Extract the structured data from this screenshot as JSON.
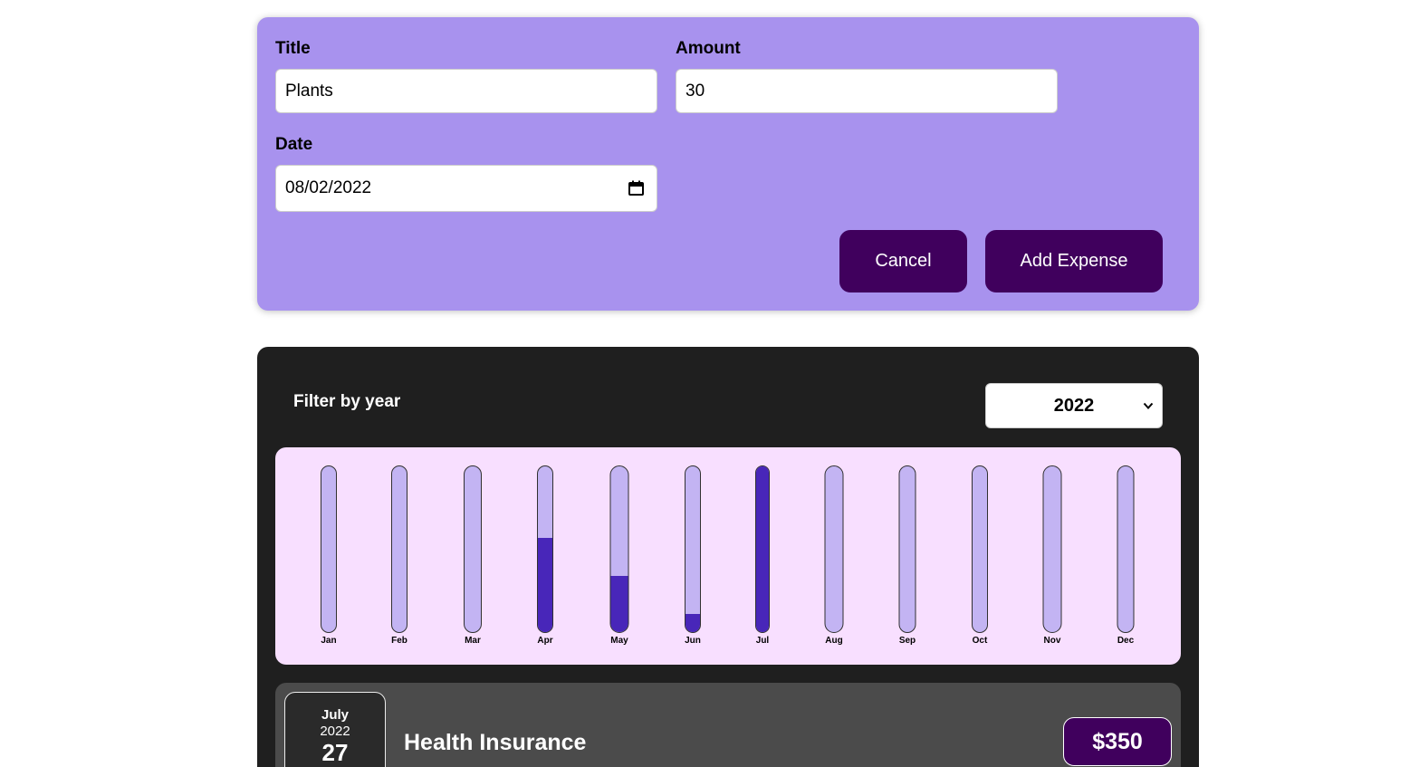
{
  "form": {
    "title_label": "Title",
    "title_value": "Plants",
    "amount_label": "Amount",
    "amount_value": "30",
    "date_label": "Date",
    "date_value": "08/02/2022",
    "cancel_label": "Cancel",
    "submit_label": "Add Expense"
  },
  "filter": {
    "label": "Filter by year",
    "selected_year": "2022"
  },
  "chart_data": {
    "type": "bar",
    "categories": [
      "Jan",
      "Feb",
      "Mar",
      "Apr",
      "May",
      "Jun",
      "Jul",
      "Aug",
      "Sep",
      "Oct",
      "Nov",
      "Dec"
    ],
    "values": [
      0,
      0,
      0,
      0.57,
      0.34,
      0.11,
      1.0,
      0,
      0,
      0,
      0,
      0
    ],
    "ylim": [
      0,
      1
    ],
    "colors": {
      "fill": "#4826b9",
      "track": "#c3b4f3",
      "background": "#f8dfff"
    }
  },
  "expenses": [
    {
      "month": "July",
      "year": "2022",
      "day": "27",
      "title": "Health Insurance",
      "amount": "$350"
    }
  ],
  "colors": {
    "form_bg": "#a892ee",
    "button_bg": "#40005d",
    "card_bg": "#1f1f1f",
    "item_bg": "#4b4b4b"
  }
}
